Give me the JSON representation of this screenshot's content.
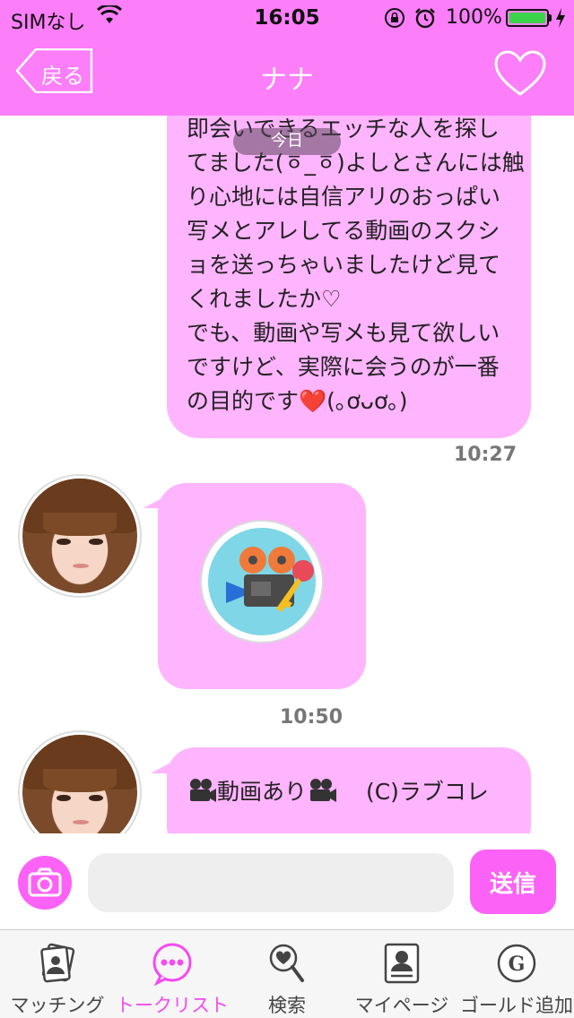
{
  "status_bar": {
    "carrier": "SIMなし",
    "time": "16:05",
    "battery_pct": "100%",
    "battery_level": 1.0,
    "icons": [
      "wifi-icon",
      "orientation-lock-icon",
      "alarm-icon",
      "battery-icon",
      "charging-bolt-icon"
    ]
  },
  "nav": {
    "back_label": "戻る",
    "title": "ナナ",
    "favorite_icon": "heart-outline-icon"
  },
  "chat": {
    "date_label": "今日",
    "messages": [
      {
        "from": "me",
        "lines": [
          "即会いできるエッチな人を探し",
          "てました(ㆆ_ㆆ)よしとさんには触",
          "り心地には自信アリのおっぱい",
          "写メとアレしてる動画のスクシ",
          "ョを送っちゃいましたけど見て",
          "くれましたか♡",
          "でも、動画や写メも見て欲しい",
          "ですけど、実際に会うのが一番",
          "の目的です❤️(｡ơᴗơ｡)"
        ],
        "time": "10:27"
      },
      {
        "from": "nana",
        "type": "locked-video",
        "icon": "locked-video-camera-icon",
        "time": "10:50"
      },
      {
        "from": "nana",
        "text": "動画あり",
        "credit": "(C)ラブコレ",
        "icon": "movie-camera-icon"
      }
    ]
  },
  "input": {
    "camera_icon": "camera-icon",
    "placeholder": "",
    "send_label": "送信"
  },
  "tabs": [
    {
      "label": "マッチング",
      "icon": "matching-cards-icon",
      "active": false
    },
    {
      "label": "トークリスト",
      "icon": "chat-bubble-icon",
      "active": true
    },
    {
      "label": "検索",
      "icon": "heart-search-icon",
      "active": false
    },
    {
      "label": "マイページ",
      "icon": "profile-card-icon",
      "active": false
    },
    {
      "label": "ゴールド追加",
      "icon": "gold-coin-icon",
      "active": false
    }
  ],
  "colors": {
    "header": "#fc7ef9",
    "bubble": "#ffb4fe",
    "accent": "#fc62f6",
    "active_tab": "#f44bf0"
  }
}
